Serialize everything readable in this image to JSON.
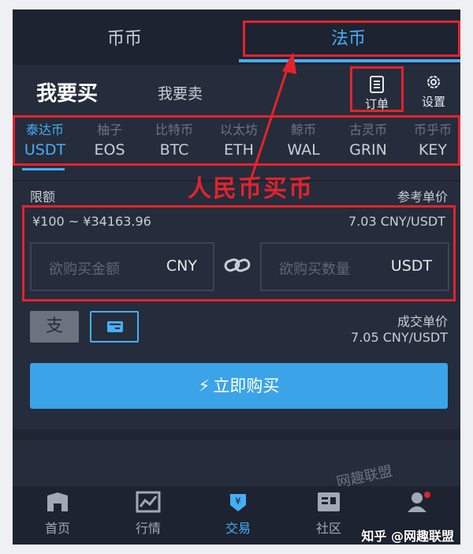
{
  "top_tabs": [
    {
      "label": "币币",
      "active": false
    },
    {
      "label": "法币",
      "active": true
    }
  ],
  "header": {
    "buy_label": "我要买",
    "sell_label": "我要卖",
    "orders_label": "订单",
    "settings_label": "设置"
  },
  "coins": [
    {
      "zh": "泰达币",
      "code": "USDT",
      "active": true
    },
    {
      "zh": "柚子",
      "code": "EOS"
    },
    {
      "zh": "比特币",
      "code": "BTC"
    },
    {
      "zh": "以太坊",
      "code": "ETH"
    },
    {
      "zh": "鲸币",
      "code": "WAL"
    },
    {
      "zh": "古灵币",
      "code": "GRIN"
    },
    {
      "zh": "币乎币",
      "code": "KEY"
    }
  ],
  "annotation": "人民币买币",
  "trade": {
    "limit_label": "限额",
    "ref_price_label": "参考单价",
    "limit_value": "¥100 ~ ¥34163.96",
    "ref_price_value": "7.03 CNY/USDT",
    "amount_placeholder": "欲购买金额",
    "amount_unit": "CNY",
    "qty_placeholder": "欲购买数量",
    "qty_unit": "USDT",
    "deal_price_label": "成交单价",
    "deal_price_value": "7.05 CNY/USDT",
    "buy_button": "立即购买",
    "alipay_glyph": "支"
  },
  "nav": [
    {
      "label": "首页",
      "icon": "home-icon"
    },
    {
      "label": "行情",
      "icon": "chart-icon"
    },
    {
      "label": "交易",
      "icon": "trade-icon",
      "active": true
    },
    {
      "label": "社区",
      "icon": "community-icon"
    },
    {
      "label": "",
      "icon": "profile-icon"
    }
  ],
  "watermark": "网趣联盟",
  "source_credit": "知乎 @网趣联盟",
  "colors": {
    "accent": "#46aef6",
    "annotation_red": "#e3232c",
    "background": "#252c3b"
  }
}
